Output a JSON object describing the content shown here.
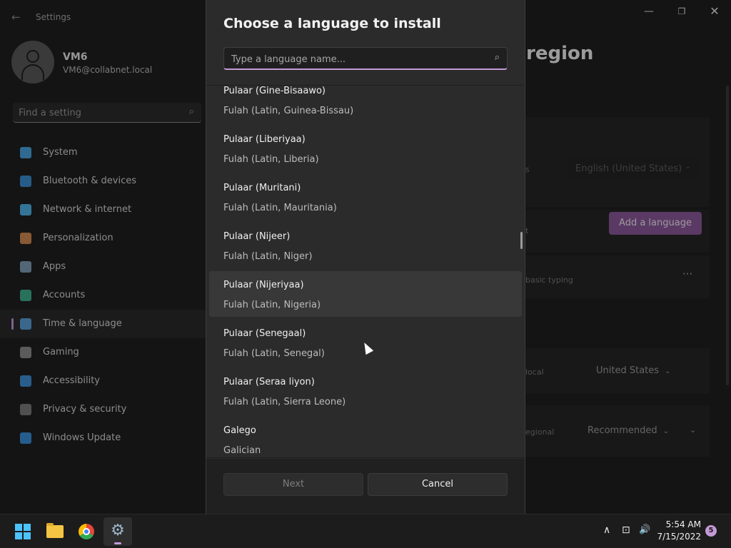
{
  "window": {
    "app_title": "Settings",
    "back_glyph": "←",
    "min_glyph": "—",
    "max_glyph": "❐",
    "close_glyph": "✕"
  },
  "user": {
    "name": "VM6",
    "email": "VM6@collabnet.local"
  },
  "search": {
    "placeholder": "Find a setting",
    "icon": "search-icon"
  },
  "nav": {
    "items": [
      {
        "label": "System",
        "icon": "system-icon",
        "color": "#4aa3df"
      },
      {
        "label": "Bluetooth & devices",
        "icon": "bluetooth-icon",
        "color": "#3b8ed0"
      },
      {
        "label": "Network & internet",
        "icon": "wifi-icon",
        "color": "#4fb3e8"
      },
      {
        "label": "Personalization",
        "icon": "brush-icon",
        "color": "#d18b52"
      },
      {
        "label": "Apps",
        "icon": "apps-icon",
        "color": "#7f9fb5"
      },
      {
        "label": "Accounts",
        "icon": "accounts-icon",
        "color": "#3fae8c"
      },
      {
        "label": "Time & language",
        "icon": "globe-clock-icon",
        "color": "#5a9fd6"
      },
      {
        "label": "Gaming",
        "icon": "controller-icon",
        "color": "#8c8c8c"
      },
      {
        "label": "Accessibility",
        "icon": "accessibility-icon",
        "color": "#3f8fd6"
      },
      {
        "label": "Privacy & security",
        "icon": "shield-icon",
        "color": "#7b7b7b"
      },
      {
        "label": "Windows Update",
        "icon": "update-icon",
        "color": "#3a8fd9"
      }
    ],
    "active_index": 6
  },
  "background": {
    "page_heading": "region",
    "display_language": "English (United States)",
    "add_language_label": "Add a language",
    "basic_typing_text": "basic typing",
    "more_glyph": "···",
    "country_label": "United States",
    "regional_format_label": "Recommended",
    "partial_labels": [
      "s",
      "t",
      "local",
      "egional"
    ],
    "chevron": "⌄"
  },
  "dialog": {
    "title": "Choose a language to install",
    "search_placeholder": "Type a language name...",
    "hovered_index": 4,
    "languages": [
      {
        "native": "Pulaar (Gine-Bisaawo)",
        "english": "Fulah (Latin, Guinea-Bissau)"
      },
      {
        "native": "Pulaar (Liberiyaa)",
        "english": "Fulah (Latin, Liberia)"
      },
      {
        "native": "Pulaar (Muritani)",
        "english": "Fulah (Latin, Mauritania)"
      },
      {
        "native": "Pulaar (Nijeer)",
        "english": "Fulah (Latin, Niger)"
      },
      {
        "native": "Pulaar (Nijeriyaa)",
        "english": "Fulah (Latin, Nigeria)"
      },
      {
        "native": "Pulaar (Senegaal)",
        "english": "Fulah (Latin, Senegal)"
      },
      {
        "native": "Pulaar (Seraa liyon)",
        "english": "Fulah (Latin, Sierra Leone)"
      },
      {
        "native": "Galego",
        "english": "Galician"
      }
    ],
    "next_label": "Next",
    "cancel_label": "Cancel"
  },
  "taskbar": {
    "apps": [
      {
        "name": "start",
        "icon": "windows-logo-icon"
      },
      {
        "name": "file-explorer",
        "icon": "folder-icon"
      },
      {
        "name": "chrome",
        "icon": "chrome-icon"
      },
      {
        "name": "settings",
        "icon": "gear-icon"
      }
    ],
    "tray": {
      "chevron_glyph": "∧",
      "network_glyph": "⊡",
      "volume_glyph": "🔊"
    },
    "time": "5:54 AM",
    "date": "7/15/2022",
    "notification_count": "5"
  },
  "colors": {
    "accent": "#c49ad6",
    "add_button": "#8a5a9a"
  }
}
